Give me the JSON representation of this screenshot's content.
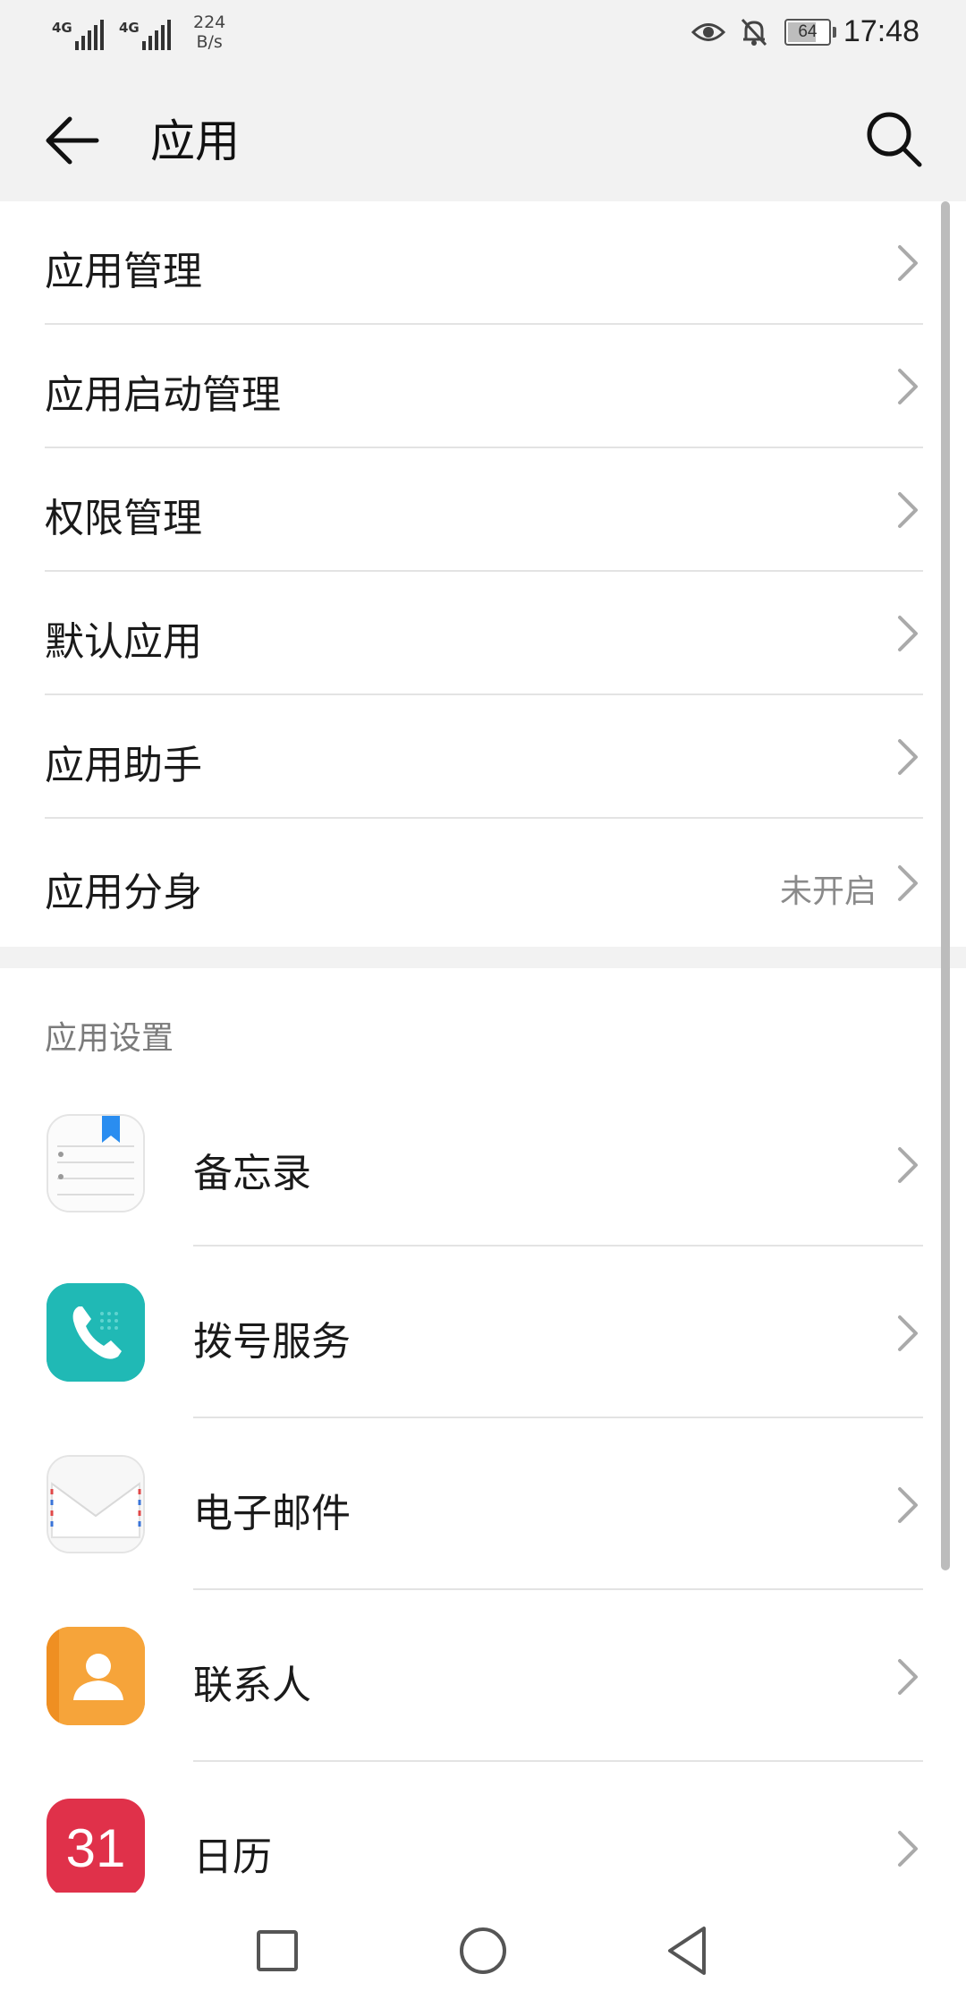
{
  "status_bar": {
    "signal1_label": "4G",
    "signal2_label": "4G",
    "speed_value": "224",
    "speed_unit": "B/s",
    "battery_level": "64",
    "time": "17:48",
    "icons": [
      "eye-icon",
      "bell-off-icon",
      "battery-icon"
    ]
  },
  "header": {
    "title": "应用",
    "back_icon": "arrow-left-icon",
    "search_icon": "search-icon"
  },
  "menu": {
    "items": [
      {
        "label": "应用管理"
      },
      {
        "label": "应用启动管理"
      },
      {
        "label": "权限管理"
      },
      {
        "label": "默认应用"
      },
      {
        "label": "应用助手"
      },
      {
        "label": "应用分身",
        "value": "未开启"
      }
    ]
  },
  "app_settings": {
    "section_title": "应用设置",
    "apps": [
      {
        "label": "备忘录",
        "icon": "notepad-icon"
      },
      {
        "label": "拨号服务",
        "icon": "phone-icon"
      },
      {
        "label": "电子邮件",
        "icon": "mail-icon"
      },
      {
        "label": "联系人",
        "icon": "contacts-icon"
      },
      {
        "label": "日历",
        "icon": "calendar-icon",
        "icon_text": "31"
      }
    ]
  },
  "nav_bar": {
    "icons": [
      "recent-apps-icon",
      "home-icon",
      "back-icon"
    ]
  },
  "colors": {
    "background": "#f2f2f2",
    "panel": "#ffffff",
    "phone_teal": "#20b9b5",
    "contacts_orange": "#f6a43a",
    "calendar_red": "#e0314a",
    "notepad_blue": "#2a8df0"
  }
}
